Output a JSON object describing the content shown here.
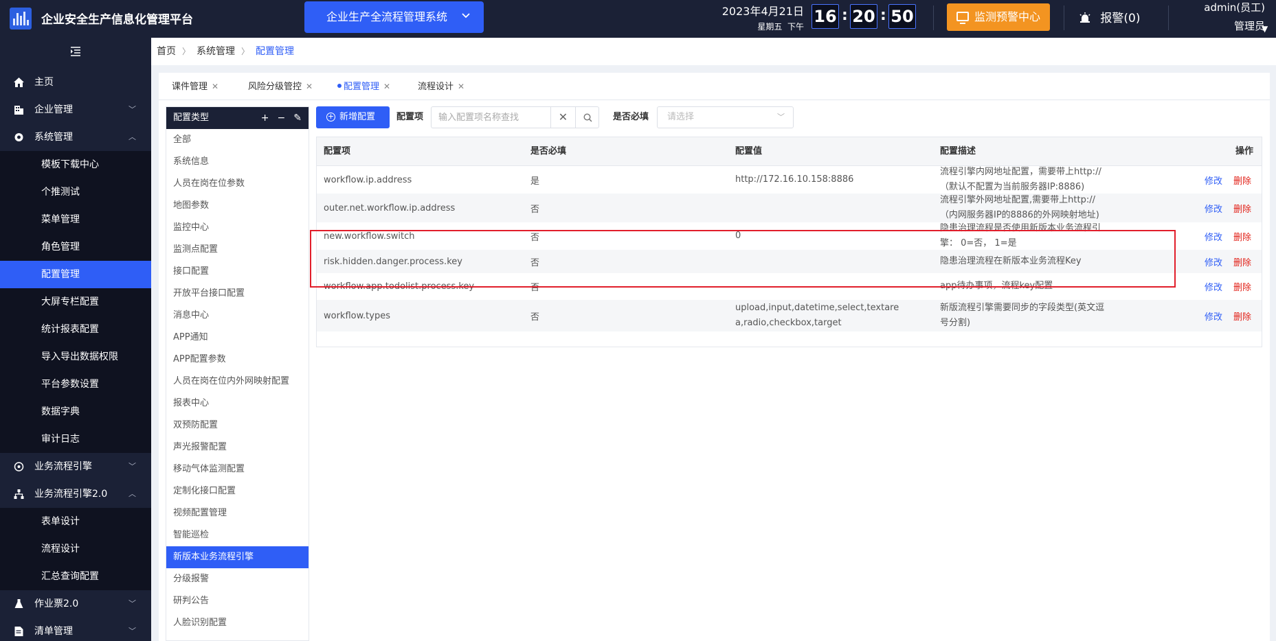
{
  "header": {
    "app_title": "企业安全生产信息化管理平台",
    "system_select": "企业生产全流程管理系统",
    "date": "2023年4月21日",
    "weekday": "星期五",
    "ampm": "下午",
    "hour": "16",
    "minute": "20",
    "second": "50",
    "monitor_label": "监测预警中心",
    "alarm_label": "报警(0)",
    "user_name": "admin(员工)",
    "user_role": "管理员"
  },
  "sidebar": {
    "items": [
      {
        "label": "主页"
      },
      {
        "label": "企业管理"
      },
      {
        "label": "系统管理"
      },
      {
        "label": "模板下载中心"
      },
      {
        "label": "个推测试"
      },
      {
        "label": "菜单管理"
      },
      {
        "label": "角色管理"
      },
      {
        "label": "配置管理"
      },
      {
        "label": "大屏专栏配置"
      },
      {
        "label": "统计报表配置"
      },
      {
        "label": "导入导出数据权限"
      },
      {
        "label": "平台参数设置"
      },
      {
        "label": "数据字典"
      },
      {
        "label": "审计日志"
      },
      {
        "label": "业务流程引擎"
      },
      {
        "label": "业务流程引擎2.0"
      },
      {
        "label": "表单设计"
      },
      {
        "label": "流程设计"
      },
      {
        "label": "汇总查询配置"
      },
      {
        "label": "作业票2.0"
      },
      {
        "label": "清单管理"
      }
    ]
  },
  "breadcrumb": [
    "首页",
    "系统管理",
    "配置管理"
  ],
  "tabs": [
    {
      "label": "课件管理"
    },
    {
      "label": "风险分级管控"
    },
    {
      "label": "配置管理"
    },
    {
      "label": "流程设计"
    }
  ],
  "types_panel": {
    "title": "配置类型",
    "items": [
      "全部",
      "系统信息",
      "人员在岗在位参数",
      "地图参数",
      "监控中心",
      "监测点配置",
      "接口配置",
      "开放平台接口配置",
      "消息中心",
      "APP通知",
      "APP配置参数",
      "人员在岗在位内外网映射配置",
      "报表中心",
      "双预防配置",
      "声光报警配置",
      "移动气体监测配置",
      "定制化接口配置",
      "视频配置管理",
      "智能巡检",
      "新版本业务流程引擎",
      "分级报警",
      "研判公告",
      "人脸识别配置"
    ]
  },
  "toolbar": {
    "add_label": "新增配置",
    "search_label": "配置项",
    "search_placeholder": "输入配置项名称查找",
    "required_label": "是否必填",
    "required_placeholder": "请选择"
  },
  "table": {
    "headers": [
      "配置项",
      "是否必填",
      "配置值",
      "配置描述",
      "操作"
    ],
    "edit_label": "修改",
    "delete_label": "删除",
    "rows": [
      {
        "key": "workflow.ip.address",
        "required": "是",
        "value": "http://172.16.10.158:8886",
        "desc": "流程引擎内网地址配置，需要带上http://（默认不配置为当前服务器IP:8886)"
      },
      {
        "key": "outer.net.workflow.ip.address",
        "required": "否",
        "value": "",
        "desc": "流程引擎外网地址配置,需要带上http://（内网服务器IP的8886的外网映射地址)"
      },
      {
        "key": "new.workflow.switch",
        "required": "否",
        "value": "0",
        "desc": "隐患治理流程是否使用新版本业务流程引擎： 0=否， 1=是"
      },
      {
        "key": "risk.hidden.danger.process.key",
        "required": "否",
        "value": "",
        "desc": "隐患治理流程在新版本业务流程Key"
      },
      {
        "key": "workflow.app.todolist.process.key",
        "required": "否",
        "value": "",
        "desc": "app待办事项，流程key配置"
      },
      {
        "key": "workflow.types",
        "required": "否",
        "value": "upload,input,datetime,select,textarea,radio,checkbox,target",
        "desc": "新版流程引擎需要同步的字段类型(英文逗号分割)"
      }
    ]
  },
  "colors": {
    "header_bg": "#1b2136",
    "accent": "#2f5ef6",
    "orange": "#f39421",
    "danger": "#e2231a",
    "highlight": "#e11d2a"
  }
}
